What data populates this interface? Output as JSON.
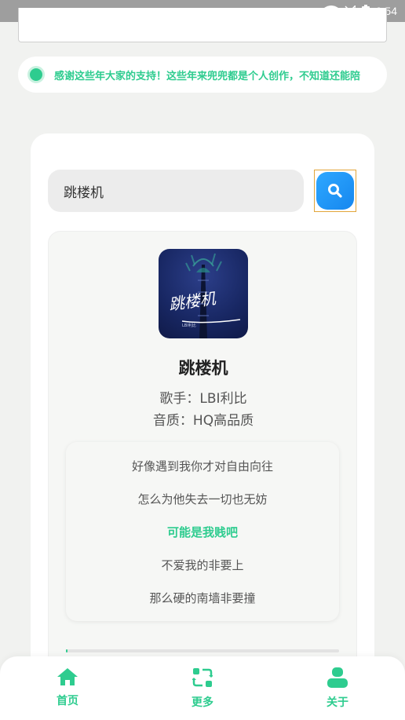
{
  "status_bar": {
    "time": "9:54",
    "icons": [
      "wifi-icon",
      "signal-off-icon",
      "battery-icon"
    ]
  },
  "notice": {
    "text": "感谢这些年大家的支持！这些年来兜兜都是个人创作，不知道还能陪"
  },
  "search": {
    "value": "跳楼机",
    "button_icon": "search-icon"
  },
  "song": {
    "title": "跳楼机",
    "artist": "歌手：LBI利比",
    "quality": "音质：HQ高品质",
    "cover_text": "跳楼机",
    "cover_subtitle": "LBI利比"
  },
  "lyrics": [
    {
      "text": "好像遇到我你才对自由向往",
      "active": false
    },
    {
      "text": "怎么为他失去一切也无妨",
      "active": false
    },
    {
      "text": "可能是我贱吧",
      "active": true
    },
    {
      "text": "不爱我的非要上",
      "active": false
    },
    {
      "text": "那么硬的南墙非要撞",
      "active": false
    }
  ],
  "playback": {
    "progress": 0.005
  },
  "nav": {
    "items": [
      {
        "label": "首页",
        "icon": "home-icon"
      },
      {
        "label": "更多",
        "icon": "swap-icon"
      },
      {
        "label": "关于",
        "icon": "user-icon"
      }
    ]
  },
  "colors": {
    "accent": "#2ecc8f",
    "search_button": "#1a8ff5",
    "status_bar": "#9e9e9e"
  }
}
